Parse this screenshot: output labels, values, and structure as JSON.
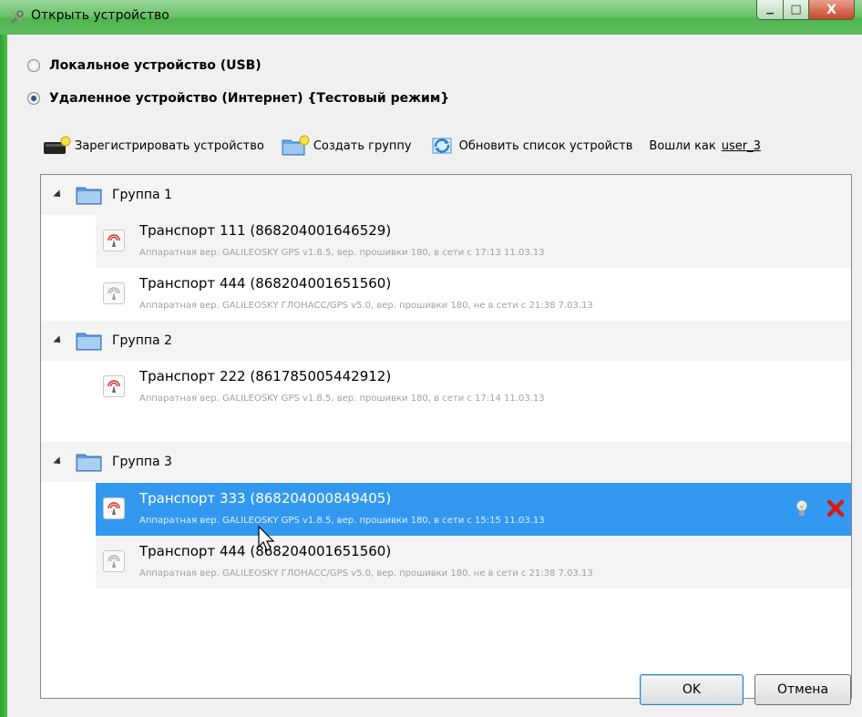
{
  "window": {
    "title": "Открыть устройство",
    "title_icon": "wrench-tools-icon",
    "minimize_glyph": "▁",
    "maximize_glyph": "□",
    "close_glyph": "X"
  },
  "connection": {
    "local_label": "Локальное устройство (USB)",
    "remote_label": "Удаленное устройство (Интернет) {Тестовый режим}",
    "selected": "remote"
  },
  "toolbar": {
    "register_label": "Зарегистрировать устройство",
    "create_group_label": "Создать группу",
    "refresh_label": "Обновить список устройств",
    "logged_in_prefix": "Вошли как",
    "user_name": "user_3"
  },
  "groups": [
    {
      "label": "Группа 1",
      "devices": [
        {
          "title": "Транспорт 111 (868204001646529)",
          "subtitle": "Аппаратная вер. GALILEOSKY GPS v1.8.5, вер. прошивки 180, в сети с 17:13 11.03.13",
          "online": true
        },
        {
          "title": "Транспорт 444 (868204001651560)",
          "subtitle": "Аппаратная вер. GALILEOSKY ГЛОНАСС/GPS v5.0, вер. прошивки 180, не в сети с 21:38 7.03.13",
          "online": false
        }
      ]
    },
    {
      "label": "Группа 2",
      "devices": [
        {
          "title": "Транспорт 222 (861785005442912)",
          "subtitle": "Аппаратная вер. GALILEOSKY GPS v1.8.5, вер. прошивки 180, в сети с 17:14 11.03.13",
          "online": true
        }
      ]
    },
    {
      "label": "Группа 3",
      "devices": [
        {
          "title": "Транспорт 333 (868204000849405)",
          "subtitle": "Аппаратная вер. GALILEOSKY GPS v1.8.5, вер. прошивки 180, в сети с 15:15 11.03.13",
          "online": true,
          "selected": true
        },
        {
          "title": "Транспорт 444 (868204001651560)",
          "subtitle": "Аппаратная вер. GALILEOSKY ГЛОНАСС/GPS v5.0, вер. прошивки 180, не в сети с 21:38 7.03.13",
          "online": false
        }
      ]
    }
  ],
  "buttons": {
    "ok_label": "OK",
    "cancel_label": "Отмена"
  },
  "colors": {
    "titlebar": "#6cc56c",
    "selection": "#3399f0",
    "online_icon": "#d9302a",
    "offline_icon": "#b0b0b0",
    "delete_icon": "#d61a1a"
  }
}
